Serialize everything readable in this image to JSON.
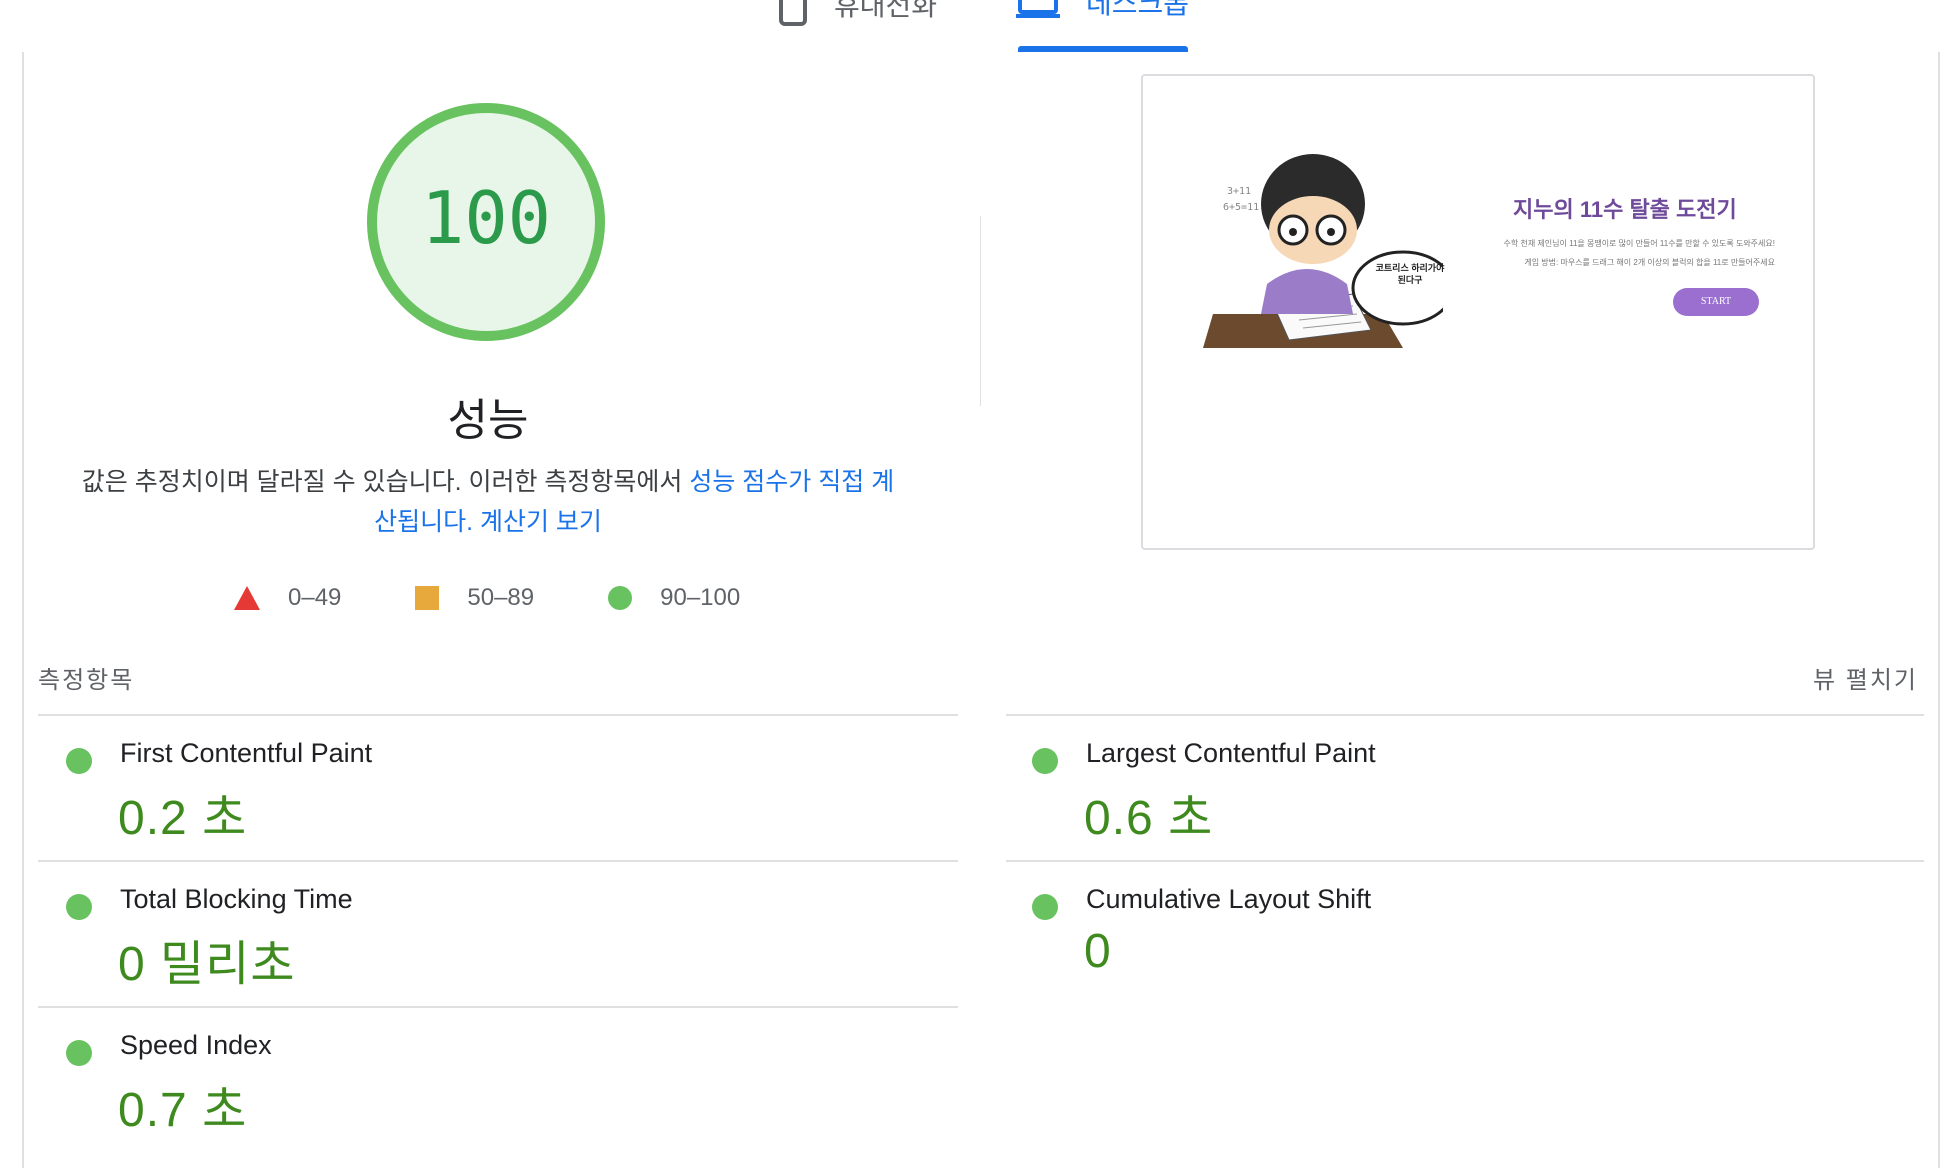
{
  "tabs": {
    "mobile_label": "휴대전화",
    "desktop_label": "데스크톱"
  },
  "score": {
    "value": "100",
    "fraction": 1.0,
    "title": "성능",
    "color": "#67c25f"
  },
  "description": {
    "text": "값은 추정치이며 달라질 수 있습니다. 이러한 측정항목에서 ",
    "link1": "성능 점수가 직접 계산됩니다.",
    "link2": "계산기 보기"
  },
  "legend": {
    "fail": "0–49",
    "average": "50–89",
    "pass": "90–100",
    "fail_color": "#e53935",
    "average_color": "#e8a93c",
    "pass_color": "#67c25f"
  },
  "screenshot": {
    "title": "지누의 11수 탈출 도전기",
    "subtitle_line1": "수학 천재 제인님이 11을 몽땡이로 많이 만들어 11수를 만할 수 있도록 도와주세요!",
    "subtitle_line2": "게임 방법: 마우스를 드래그 해이 2개 이상의 블럭의 합을 11로 만들어주세요",
    "bubble_text": "코트리스 하리가야된다구",
    "button_label": "START"
  },
  "metrics_section": {
    "title": "측정항목",
    "expand_label": "뷰 펼치기"
  },
  "metrics": {
    "fcp": {
      "name": "First Contentful Paint",
      "value": "0.2 초"
    },
    "lcp": {
      "name": "Largest Contentful Paint",
      "value": "0.6 초"
    },
    "tbt": {
      "name": "Total Blocking Time",
      "value": "0 밀리초"
    },
    "cls": {
      "name": "Cumulative Layout Shift",
      "value": "0"
    },
    "si": {
      "name": "Speed Index",
      "value": "0.7 초"
    }
  }
}
